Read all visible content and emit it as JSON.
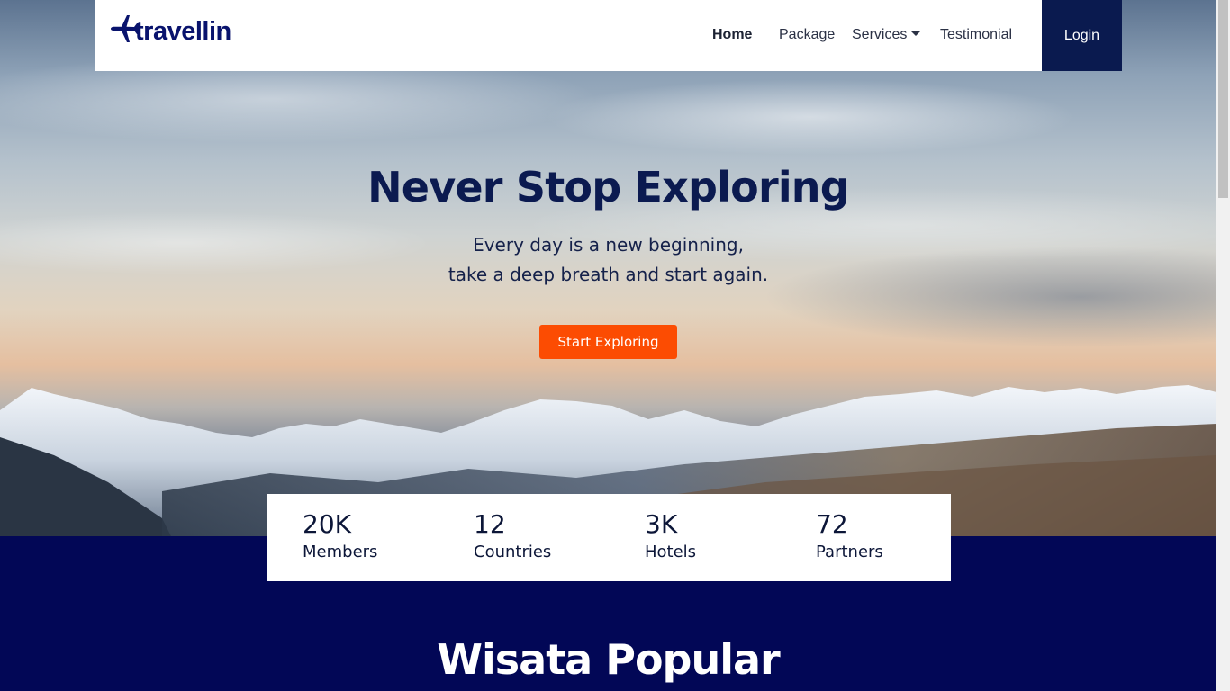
{
  "brand": {
    "name": "travellin",
    "icon": "plane-icon",
    "color": "#09136d"
  },
  "nav": {
    "items": [
      {
        "label": "Home",
        "active": true
      },
      {
        "label": "Package",
        "active": false
      },
      {
        "label": "Services",
        "active": false,
        "dropdown": true
      },
      {
        "label": "Testimonial",
        "active": false
      }
    ],
    "login_label": "Login"
  },
  "hero": {
    "title": "Never Stop Exploring",
    "subtitle_line1": "Every day is a new beginning,",
    "subtitle_line2": "take a deep breath and start again.",
    "cta_label": "Start Exploring"
  },
  "stats": [
    {
      "value": "20K",
      "label": "Members"
    },
    {
      "value": "12",
      "label": "Countries"
    },
    {
      "value": "3K",
      "label": "Hotels"
    },
    {
      "value": "72",
      "label": "Partners"
    }
  ],
  "section": {
    "title": "Wisata Popular"
  },
  "colors": {
    "accent": "#fc4c02",
    "navy": "#020756",
    "login_bg": "#0a1a4f",
    "heading": "#0b1a50"
  }
}
